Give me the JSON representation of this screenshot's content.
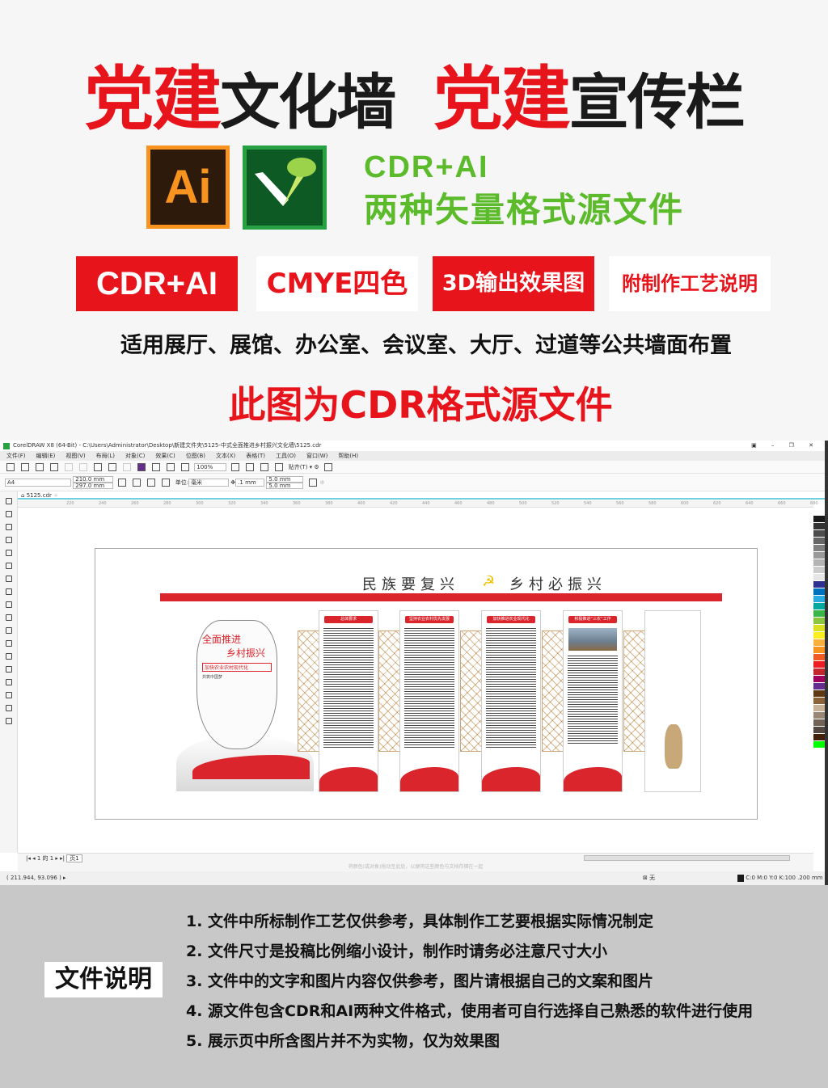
{
  "hero": {
    "title_red_1": "党建",
    "title_black_1": "文化墙",
    "title_red_2": "党建",
    "title_black_2": "宣传栏",
    "ai_logo": "Ai",
    "format_label": "CDR+AI",
    "format_desc": "两种矢量格式源文件",
    "badges": [
      "CDR+AI",
      "CMYE四色",
      "3D输出效果图",
      "附制作工艺说明"
    ],
    "usage": "适用展厅、展馆、办公室、会议室、大厅、过道等公共墙面布置",
    "source_note": "此图为CDR格式源文件"
  },
  "app": {
    "title": "CorelDRAW X8 (64-Bit) - C:\\Users\\Administrator\\Desktop\\新建文件夹\\5125-中式全面推进乡村振兴文化墙\\5125.cdr",
    "menu": [
      "文件(F)",
      "编辑(E)",
      "视图(V)",
      "布局(L)",
      "对象(C)",
      "效果(C)",
      "位图(B)",
      "文本(X)",
      "表格(T)",
      "工具(O)",
      "窗口(W)",
      "帮助(H)"
    ],
    "zoom": "100%",
    "snap": "贴齐(T)",
    "page_size": "A4",
    "width": "210.0 mm",
    "height": "297.0 mm",
    "unit_label": "单位:",
    "unit": "毫米",
    "nudge": ".1 mm",
    "dup_x": "5.0 mm",
    "dup_y": "5.0 mm",
    "tab": "5125.cdr",
    "ruler": [
      "220",
      "240",
      "260",
      "280",
      "300",
      "320",
      "340",
      "360",
      "380",
      "400",
      "420",
      "440",
      "460",
      "480",
      "500",
      "520",
      "540",
      "560",
      "580",
      "600",
      "620",
      "640",
      "660",
      "680"
    ],
    "page_nav": "1 的 1",
    "page_tab": "页1",
    "hint": "将颜色(或对象)拖动至此处，以便将这些颜色与文档存储在一起",
    "coords": "( 211.944, 93.096 )",
    "fill_none": "无",
    "outline": "C:0 M:0 Y:0 K:100  .200 mm",
    "palette": [
      "#1a1a1a",
      "#333",
      "#4d4d4d",
      "#666",
      "#808080",
      "#999",
      "#b3b3b3",
      "#ccc",
      "#e6e6e6",
      "#2e3192",
      "#0071bc",
      "#29abe2",
      "#00a99d",
      "#39b54a",
      "#8cc63f",
      "#d9e021",
      "#fcee21",
      "#fbb03b",
      "#f7931e",
      "#f15a24",
      "#ed1c24",
      "#c1272d",
      "#9e005d",
      "#662d91",
      "#603813",
      "#8c6239",
      "#c7b299",
      "#998675",
      "#736357",
      "#534741",
      "#42210b",
      "#00ff00"
    ]
  },
  "artwork": {
    "headline_left": "民族要复兴",
    "headline_right": "乡村必振兴",
    "board_line1": "全面推进",
    "board_line2": "乡村振兴",
    "board_sub": "加快农业农村现代化",
    "board_small": "共筑中国梦",
    "panels": [
      "总体要求",
      "坚持农业农村优先发展",
      "加快推进农业现代化",
      "积极推进“三农”工作"
    ]
  },
  "notes": {
    "label": "文件说明",
    "items": [
      "1. 文件中所标制作工艺仅供参考，具体制作工艺要根据实际情况制定",
      "2. 文件尺寸是投稿比例缩小设计，制作时请务必注意尺寸大小",
      "3. 文件中的文字和图片内容仅供参考，图片请根据自己的文案和图片",
      "4. 源文件包含CDR和AI两种文件格式，使用者可自行选择自己熟悉的软件进行使用",
      "5. 展示页中所含图片并不为实物，仅为效果图"
    ]
  },
  "colors": {
    "red": "#e8141c",
    "green": "#5cbb2a",
    "ai_orange": "#f7931e",
    "gray": "#c8c8c8"
  }
}
